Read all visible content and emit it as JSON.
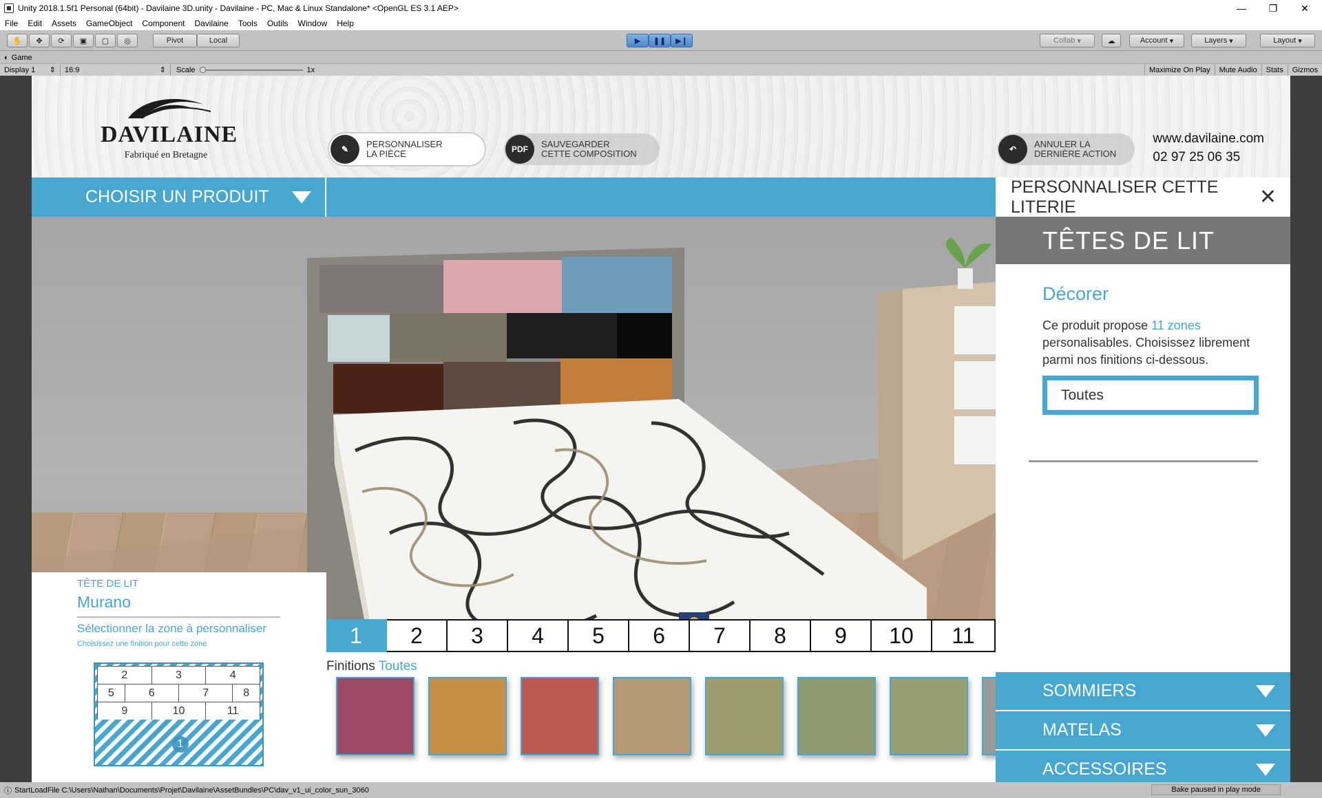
{
  "window": {
    "title": "Unity 2018.1.5f1 Personal (64bit) - Davilaine 3D.unity - Davilaine - PC, Mac & Linux Standalone* <OpenGL ES 3.1 AEP>"
  },
  "menu": [
    "File",
    "Edit",
    "Assets",
    "GameObject",
    "Component",
    "Davilaine",
    "Tools",
    "Outils",
    "Window",
    "Help"
  ],
  "toolbar": {
    "pivot": "Pivot",
    "local": "Local",
    "collab": "Collab",
    "account": "Account",
    "layers": "Layers",
    "layout": "Layout"
  },
  "game": {
    "tab": "Game",
    "display": "Display 1",
    "aspect": "16:9",
    "scale_label": "Scale",
    "scale_value": "1x",
    "maximize": "Maximize On Play",
    "mute": "Mute Audio",
    "stats": "Stats",
    "gizmos": "Gizmos"
  },
  "app": {
    "logo": {
      "brand": "DAVILAINE",
      "tagline": "Fabriqué en Bretagne"
    },
    "btn_personnaliser": {
      "line1": "PERSONNALISER",
      "line2": "LA PIÈCE"
    },
    "btn_sauvegarder": {
      "icon": "PDF",
      "line1": "SAUVEGARDER",
      "line2": "CETTE COMPOSITION"
    },
    "btn_annuler": {
      "line1": "ANNULER LA",
      "line2": "DERNIÈRE ACTION"
    },
    "website": "www.davilaine.com",
    "phone": "02 97 25 06 35",
    "choose_product": "CHOISIR UN PRODUIT",
    "panel": {
      "title": "PERSONNALISER CETTE LITERIE",
      "section": "TÊTES DE LIT",
      "heading": "Décorer",
      "text_before": "Ce produit propose ",
      "text_zones": "11 zones",
      "text_after": " personalisables. Choisissez librement parmi nos finitions ci-dessous.",
      "select_value": "Toutes"
    },
    "accordions": [
      "SOMMIERS",
      "MATELAS",
      "ACCESSOIRES"
    ],
    "card": {
      "kind": "TÊTE DE LIT",
      "name": "Murano",
      "select_zone": "Sélectionner la zone à personnaliser",
      "hint": "Choisissez une finition pour cette zone"
    },
    "zone_map": [
      [
        "2",
        "3",
        "4"
      ],
      [
        "5",
        "6",
        "7",
        "8"
      ],
      [
        "9",
        "10",
        "11"
      ]
    ],
    "zone_map_active": "1",
    "zones": [
      "1",
      "2",
      "3",
      "4",
      "5",
      "6",
      "7",
      "8",
      "9",
      "10",
      "11"
    ],
    "active_zone": "1",
    "finitions_label": "Finitions",
    "finitions_filter": "Toutes",
    "swatches": [
      "#a04a68",
      "#c98f45",
      "#bb5a50",
      "#b39a72",
      "#9f9d6e",
      "#8f9a6e",
      "#97a070",
      "#9a9a9a"
    ]
  },
  "headboard_tiles": [
    "#7d7672",
    "#dca8ac",
    "#6e9cbd",
    "#c4d6d6",
    "#7c7465",
    "#1f1f1f",
    "#0a0a0a",
    "#4a2218",
    "#5c4a40",
    "#c47e3b"
  ],
  "status": {
    "message": "StartLoadFile C:\\Users\\Nathan\\Documents\\Projet\\Davilaine\\AssetBundles\\PC\\dav_v1_ui_color_sun_3060",
    "right": "Bake paused in play mode"
  }
}
